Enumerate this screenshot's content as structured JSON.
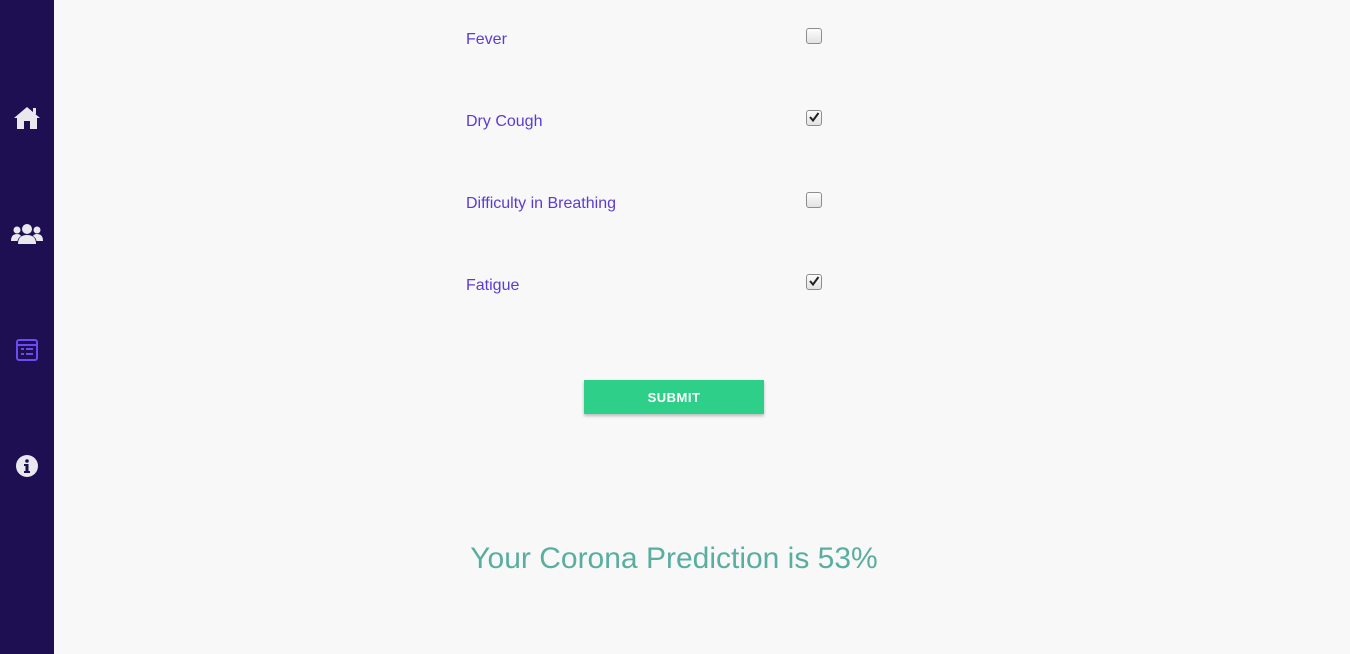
{
  "sidebar": {
    "items": [
      {
        "icon": "home-icon",
        "active": false
      },
      {
        "icon": "users-icon",
        "active": false
      },
      {
        "icon": "form-icon",
        "active": true
      },
      {
        "icon": "info-icon",
        "active": false
      }
    ],
    "colors": {
      "background": "#1e0f52",
      "icon": "#e8e8ee",
      "active_icon": "#6b4cf0"
    }
  },
  "form": {
    "symptoms": [
      {
        "label": "Fever",
        "checked": false
      },
      {
        "label": "Dry Cough",
        "checked": true
      },
      {
        "label": "Difficulty in Breathing",
        "checked": false
      },
      {
        "label": "Fatigue",
        "checked": true
      }
    ],
    "submit_label": "SUBMIT"
  },
  "result": {
    "text": "Your Corona Prediction is 53%"
  },
  "colors": {
    "label": "#5b3cd3",
    "submit": "#2ecf88",
    "result": "#5aaea0"
  }
}
